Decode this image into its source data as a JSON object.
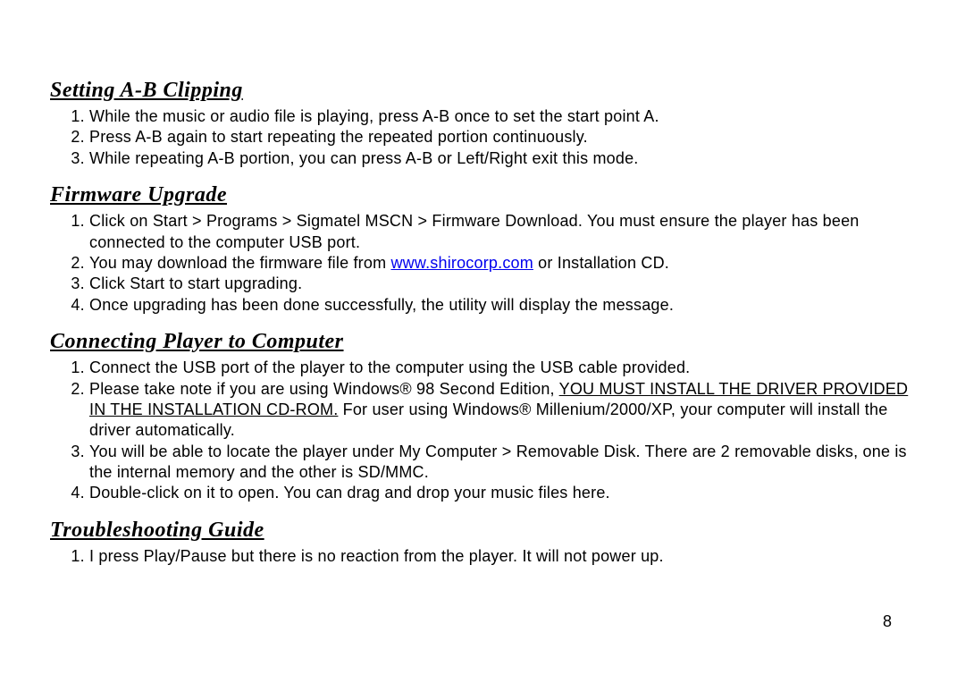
{
  "page_number": "8",
  "sections": {
    "ab_clipping": {
      "heading": "Setting A-B Clipping",
      "items": [
        "While the music or audio file is playing, press A-B once to set the start point A.",
        "Press A-B again to start repeating the repeated portion continuously.",
        "While repeating A-B portion, you can press A-B or Left/Right exit this mode."
      ]
    },
    "firmware": {
      "heading": "Firmware Upgrade",
      "item1": "Click on Start > Programs > Sigmatel MSCN > Firmware Download. You must ensure the player has been connected to the computer USB port.",
      "item2_prefix": "You may download the firmware file from ",
      "item2_link": "www.shirocorp.com",
      "item2_suffix": " or Installation CD.",
      "item3": "Click Start to start upgrading.",
      "item4": "Once upgrading has been done successfully, the utility will display the message."
    },
    "connecting": {
      "heading": "Connecting Player to Computer",
      "item1": "Connect the USB port of the player to the computer using the USB cable provided.",
      "item2_prefix": "Please take note if you are using Windows® 98 Second Edition, ",
      "item2_underline": "YOU MUST INSTALL THE DRIVER PROVIDED IN THE INSTALLATION CD-ROM.",
      "item2_suffix": " For user using Windows® Millenium/2000/XP, your computer will install the driver automatically.",
      "item3": "You will be able to locate the player under My Computer > Removable Disk. There are 2 removable disks, one is the internal memory and the other is SD/MMC.",
      "item4": "Double-click on it to open. You can drag and drop your music files here."
    },
    "troubleshooting": {
      "heading": "Troubleshooting Guide",
      "item1": "I press Play/Pause but there is no reaction from the player. It will not power up."
    }
  }
}
